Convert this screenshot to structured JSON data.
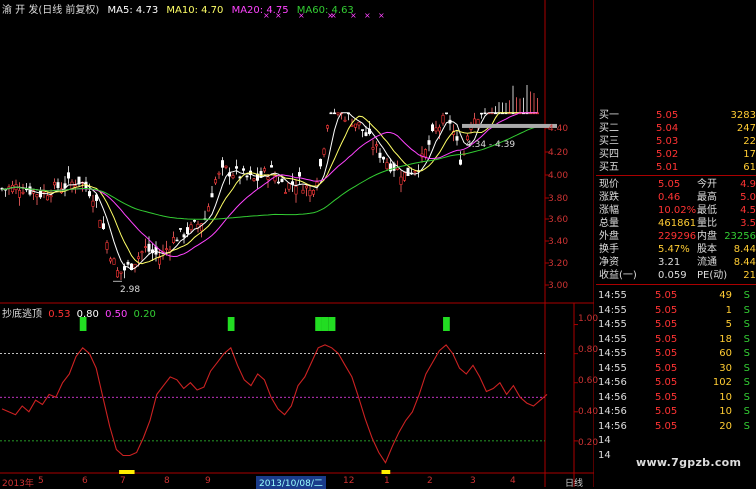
{
  "header": {
    "title": "渝 开 发(日线 前复权)",
    "ma_items": [
      {
        "label": "MA5: 4.73",
        "color": "#ffffff"
      },
      {
        "label": "MA10: 4.70",
        "color": "#ffff66"
      },
      {
        "label": "MA20: 4.75",
        "color": "#ff44ff"
      },
      {
        "label": "MA60: 4.63",
        "color": "#33cc33"
      }
    ]
  },
  "indicator": {
    "name": "抄底逃顶",
    "values": [
      {
        "label": "0.53",
        "color": "#ff3333"
      },
      {
        "label": "0.80",
        "color": "#ffffff"
      },
      {
        "label": "0.50",
        "color": "#ff44ff"
      },
      {
        "label": "0.20",
        "color": "#33cc33"
      }
    ]
  },
  "price_axis": [
    "4.40",
    "4.20",
    "4.00",
    "3.80",
    "3.60",
    "3.40",
    "3.20",
    "3.00"
  ],
  "indicator_axis": [
    "1.00",
    "0.80",
    "0.60",
    "0.40",
    "0.20"
  ],
  "annotations": {
    "low_price": "2.98",
    "range_label": "4.34 - 4.39"
  },
  "x_axis": {
    "labels": [
      "2013年",
      "5",
      "6",
      "7",
      "8",
      "9",
      "11",
      "12",
      "1",
      "2",
      "3",
      "4"
    ],
    "date_badge": "2013/10/08/二",
    "period_button": "日线"
  },
  "quote": {
    "book": [
      {
        "label": "买一",
        "price": "5.05",
        "vol": "3283"
      },
      {
        "label": "买二",
        "price": "5.04",
        "vol": "247"
      },
      {
        "label": "买三",
        "price": "5.03",
        "vol": "22"
      },
      {
        "label": "买四",
        "price": "5.02",
        "vol": "17"
      },
      {
        "label": "买五",
        "price": "5.01",
        "vol": "61"
      }
    ],
    "stats": [
      {
        "l1": "现价",
        "v1": "5.05",
        "l2": "今开",
        "v2": "4.9"
      },
      {
        "l1": "涨跌",
        "v1": "0.46",
        "l2": "最高",
        "v2": "5.0"
      },
      {
        "l1": "涨幅",
        "v1": "10.02%",
        "l2": "最低",
        "v2": "4.5"
      },
      {
        "l1": "总量",
        "v1": "461861",
        "l2": "量比",
        "v2": "3.5"
      },
      {
        "l1": "外盘",
        "v1": "229296",
        "l2": "内盘",
        "v2": "23256"
      },
      {
        "l1": "换手",
        "v1": "5.47%",
        "l2": "股本",
        "v2": "8.44"
      },
      {
        "l1": "净资",
        "v1": "3.21",
        "l2": "流通",
        "v2": "8.44"
      },
      {
        "l1": "收益(一)",
        "v1": "0.059",
        "l2": "PE(动)",
        "v2": "21"
      }
    ],
    "ticks": [
      {
        "time": "14:55",
        "price": "5.05",
        "vol": "49",
        "side": "S"
      },
      {
        "time": "14:55",
        "price": "5.05",
        "vol": "1",
        "side": "S"
      },
      {
        "time": "14:55",
        "price": "5.05",
        "vol": "5",
        "side": "S"
      },
      {
        "time": "14:55",
        "price": "5.05",
        "vol": "18",
        "side": "S"
      },
      {
        "time": "14:55",
        "price": "5.05",
        "vol": "60",
        "side": "S"
      },
      {
        "time": "14:55",
        "price": "5.05",
        "vol": "30",
        "side": "S"
      },
      {
        "time": "14:56",
        "price": "5.05",
        "vol": "102",
        "side": "S"
      },
      {
        "time": "14:56",
        "price": "5.05",
        "vol": "10",
        "side": "S"
      },
      {
        "time": "14:56",
        "price": "5.05",
        "vol": "10",
        "side": "S"
      },
      {
        "time": "14:56",
        "price": "5.05",
        "vol": "20",
        "side": "S"
      },
      {
        "time": "14",
        "price": "",
        "vol": "",
        "side": ""
      },
      {
        "time": "14",
        "price": "",
        "vol": "",
        "side": ""
      }
    ]
  },
  "watermark": "www.7gpzb.com",
  "chart_data": {
    "type": "line",
    "series": [
      {
        "name": "抄底逃顶",
        "values": [
          0.42,
          0.4,
          0.38,
          0.44,
          0.4,
          0.48,
          0.45,
          0.52,
          0.5,
          0.6,
          0.66,
          0.78,
          0.84,
          0.8,
          0.7,
          0.5,
          0.3,
          0.14,
          0.1,
          0.1,
          0.12,
          0.22,
          0.34,
          0.52,
          0.58,
          0.64,
          0.62,
          0.56,
          0.6,
          0.55,
          0.57,
          0.68,
          0.74,
          0.8,
          0.84,
          0.72,
          0.62,
          0.58,
          0.66,
          0.62,
          0.5,
          0.42,
          0.38,
          0.44,
          0.58,
          0.64,
          0.74,
          0.84,
          0.86,
          0.84,
          0.8,
          0.72,
          0.64,
          0.5,
          0.35,
          0.22,
          0.12,
          0.05,
          0.16,
          0.26,
          0.34,
          0.4,
          0.52,
          0.66,
          0.74,
          0.82,
          0.86,
          0.8,
          0.7,
          0.66,
          0.72,
          0.64,
          0.54,
          0.56,
          0.6,
          0.52,
          0.58,
          0.5,
          0.46,
          0.44,
          0.48,
          0.52
        ]
      }
    ],
    "ylim": [
      0,
      1.1
    ],
    "reference_lines": [
      0.8,
      0.5,
      0.2
    ]
  }
}
